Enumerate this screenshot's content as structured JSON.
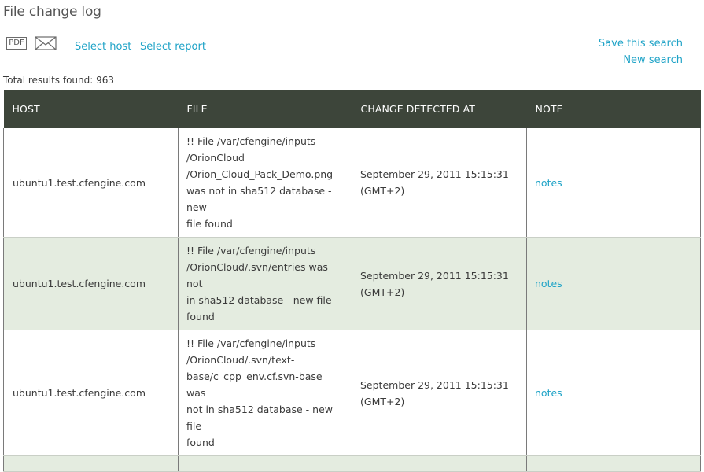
{
  "page": {
    "title": "File change log"
  },
  "toolbar": {
    "pdf_icon_label": "PDF",
    "select_host": "Select host",
    "select_report": "Select report",
    "save_search": "Save this search",
    "new_search": "New search"
  },
  "results": {
    "total_label": "Total results found: 963"
  },
  "table": {
    "headers": [
      "HOST",
      "FILE",
      "CHANGE DETECTED AT",
      "NOTE"
    ],
    "rows": [
      {
        "host": "ubuntu1.test.cfengine.com",
        "file": "!! File /var/cfengine/inputs /OrionCloud /Orion_Cloud_Pack_Demo.png was not in sha512 database - new file found",
        "file_lines": [
          "!! File /var/cfengine/inputs",
          "/OrionCloud",
          "/Orion_Cloud_Pack_Demo.png",
          "was not in sha512 database - new",
          "file found"
        ],
        "detected_lines": [
          "September 29, 2011 15:15:31",
          "(GMT+2)"
        ],
        "note": "notes"
      },
      {
        "host": "ubuntu1.test.cfengine.com",
        "file": "!! File /var/cfengine/inputs /OrionCloud/.svn/entries was not in sha512 database - new file found",
        "file_lines": [
          "!! File /var/cfengine/inputs",
          "/OrionCloud/.svn/entries was not",
          "in sha512 database - new file",
          "found"
        ],
        "detected_lines": [
          "September 29, 2011 15:15:31",
          "(GMT+2)"
        ],
        "note": "notes"
      },
      {
        "host": "ubuntu1.test.cfengine.com",
        "file": "!! File /var/cfengine/inputs /OrionCloud/.svn/text-base/c_cpp_env.cf.svn-base was not in sha512 database - new file found",
        "file_lines": [
          "!! File /var/cfengine/inputs",
          "/OrionCloud/.svn/text-",
          "base/c_cpp_env.cf.svn-base was",
          "not in sha512 database - new file",
          "found"
        ],
        "detected_lines": [
          "September 29, 2011 15:15:31",
          "(GMT+2)"
        ],
        "note": "notes"
      }
    ]
  },
  "colors": {
    "link": "#1fa3c7",
    "header_bg": "#3d453a",
    "alt_row_bg": "#e4ece0"
  }
}
